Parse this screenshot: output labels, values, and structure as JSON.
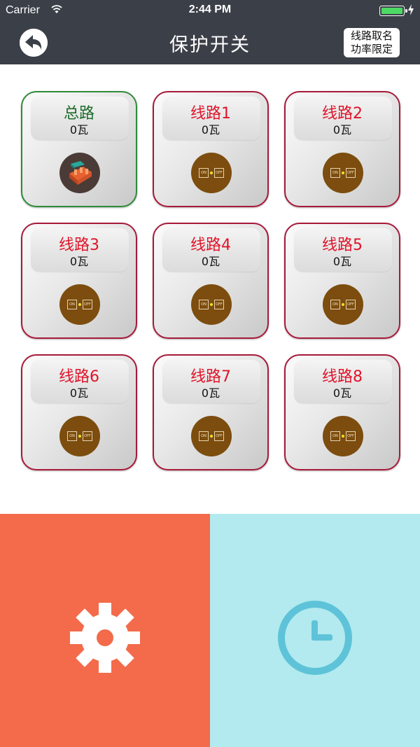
{
  "status_bar": {
    "carrier": "Carrier",
    "time": "2:44 PM",
    "battery_color": "#4cd964"
  },
  "nav": {
    "title": "保护开关",
    "back_icon": "back-arrow-icon",
    "right_button_line1": "线路取名",
    "right_button_line2": "功率限定"
  },
  "switch_labels": {
    "on": "ON",
    "off": "OFF"
  },
  "cards": [
    {
      "name": "总路",
      "power": "0瓦",
      "type": "main"
    },
    {
      "name": "线路1",
      "power": "0瓦",
      "type": "line"
    },
    {
      "name": "线路2",
      "power": "0瓦",
      "type": "line"
    },
    {
      "name": "线路3",
      "power": "0瓦",
      "type": "line"
    },
    {
      "name": "线路4",
      "power": "0瓦",
      "type": "line"
    },
    {
      "name": "线路5",
      "power": "0瓦",
      "type": "line"
    },
    {
      "name": "线路6",
      "power": "0瓦",
      "type": "line"
    },
    {
      "name": "线路7",
      "power": "0瓦",
      "type": "line"
    },
    {
      "name": "线路8",
      "power": "0瓦",
      "type": "line"
    }
  ],
  "bottom": {
    "left_icon": "gear-icon",
    "left_color": "#f36b4a",
    "right_icon": "clock-icon",
    "right_color": "#b2eaef"
  },
  "colors": {
    "header_bg": "#3b3f48",
    "main_border": "#2e8b3a",
    "line_border": "#a71a3a",
    "line_label": "#e0142a",
    "main_label": "#1c6b2a"
  }
}
